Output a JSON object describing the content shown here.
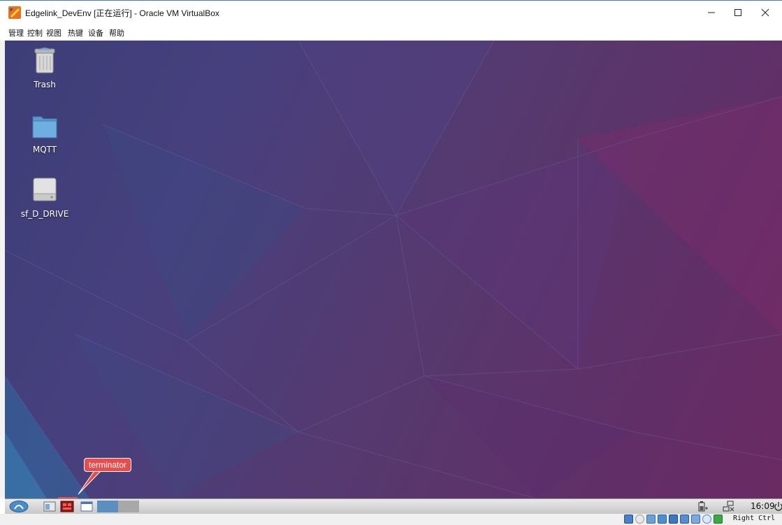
{
  "window": {
    "title": "Edgelink_DevEnv [正在运行] - Oracle VM VirtualBox"
  },
  "menubar": {
    "items": [
      "管理",
      "控制",
      "视图",
      "热键",
      "设备",
      "帮助"
    ]
  },
  "desktop": {
    "icons": [
      {
        "label": "Trash",
        "icon": "trash-icon"
      },
      {
        "label": "MQTT",
        "icon": "folder-icon"
      },
      {
        "label": "sf_D_DRIVE",
        "icon": "drive-icon"
      }
    ],
    "callout": {
      "label": "terminator"
    }
  },
  "taskbar": {
    "clock": "16:09"
  },
  "statusbar": {
    "host_key": "Right Ctrl"
  },
  "colors": {
    "callout": "#e84c4c",
    "desktop_blue": "#3c3e78",
    "desktop_magenta": "#6b2a62"
  }
}
